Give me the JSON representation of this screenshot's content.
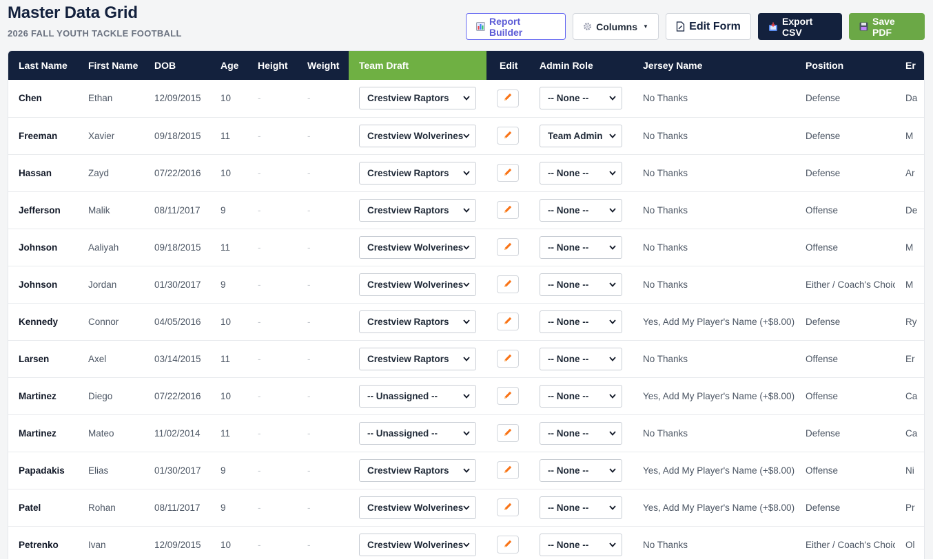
{
  "header": {
    "title": "Master Data Grid",
    "subtitle": "2026 FALL YOUTH TACKLE FOOTBALL"
  },
  "toolbar": {
    "report_builder": "Report Builder",
    "columns": "Columns",
    "edit_form": "Edit Form",
    "export_csv": "Export CSV",
    "save_pdf": "Save PDF",
    "report_icon": "chart-icon",
    "columns_icon": "gear-icon",
    "edit_form_icon": "document-edit-icon",
    "export_icon": "export-icon",
    "pdf_icon": "save-disk-icon",
    "colors": {
      "navy": "#13213d",
      "green": "#6ba846",
      "accent": "#5b5bd6"
    }
  },
  "grid": {
    "columns": [
      "Last Name",
      "First Name",
      "DOB",
      "Age",
      "Height",
      "Weight",
      "Team Draft",
      "Edit",
      "Admin Role",
      "Jersey Name",
      "Position",
      "Er"
    ],
    "rows": [
      {
        "last": "Chen",
        "first": "Ethan",
        "dob": "12/09/2015",
        "age": "10",
        "height": "-",
        "weight": "-",
        "team": "Crestview Raptors",
        "admin": "-- None --",
        "jersey": "No Thanks",
        "position": "Defense",
        "extra": "Da"
      },
      {
        "last": "Freeman",
        "first": "Xavier",
        "dob": "09/18/2015",
        "age": "11",
        "height": "-",
        "weight": "-",
        "team": "Crestview Wolverines",
        "admin": "Team Admin",
        "jersey": "No Thanks",
        "position": "Defense",
        "extra": "M"
      },
      {
        "last": "Hassan",
        "first": "Zayd",
        "dob": "07/22/2016",
        "age": "10",
        "height": "-",
        "weight": "-",
        "team": "Crestview Raptors",
        "admin": "-- None --",
        "jersey": "No Thanks",
        "position": "Defense",
        "extra": "Ar"
      },
      {
        "last": "Jefferson",
        "first": "Malik",
        "dob": "08/11/2017",
        "age": "9",
        "height": "-",
        "weight": "-",
        "team": "Crestview Raptors",
        "admin": "-- None --",
        "jersey": "No Thanks",
        "position": "Offense",
        "extra": "De"
      },
      {
        "last": "Johnson",
        "first": "Aaliyah",
        "dob": "09/18/2015",
        "age": "11",
        "height": "-",
        "weight": "-",
        "team": "Crestview Wolverines",
        "admin": "-- None --",
        "jersey": "No Thanks",
        "position": "Offense",
        "extra": "M"
      },
      {
        "last": "Johnson",
        "first": "Jordan",
        "dob": "01/30/2017",
        "age": "9",
        "height": "-",
        "weight": "-",
        "team": "Crestview Wolverines",
        "admin": "-- None --",
        "jersey": "No Thanks",
        "position": "Either / Coach's Choice",
        "extra": "M"
      },
      {
        "last": "Kennedy",
        "first": "Connor",
        "dob": "04/05/2016",
        "age": "10",
        "height": "-",
        "weight": "-",
        "team": "Crestview Raptors",
        "admin": "-- None --",
        "jersey": "Yes, Add My Player's Name (+$8.00)",
        "position": "Defense",
        "extra": "Ry"
      },
      {
        "last": "Larsen",
        "first": "Axel",
        "dob": "03/14/2015",
        "age": "11",
        "height": "-",
        "weight": "-",
        "team": "Crestview Raptors",
        "admin": "-- None --",
        "jersey": "No Thanks",
        "position": "Offense",
        "extra": "Er"
      },
      {
        "last": "Martinez",
        "first": "Diego",
        "dob": "07/22/2016",
        "age": "10",
        "height": "-",
        "weight": "-",
        "team": "-- Unassigned --",
        "admin": "-- None --",
        "jersey": "Yes, Add My Player's Name (+$8.00)",
        "position": "Offense",
        "extra": "Ca"
      },
      {
        "last": "Martinez",
        "first": "Mateo",
        "dob": "11/02/2014",
        "age": "11",
        "height": "-",
        "weight": "-",
        "team": "-- Unassigned --",
        "admin": "-- None --",
        "jersey": "No Thanks",
        "position": "Defense",
        "extra": "Ca"
      },
      {
        "last": "Papadakis",
        "first": "Elias",
        "dob": "01/30/2017",
        "age": "9",
        "height": "-",
        "weight": "-",
        "team": "Crestview Raptors",
        "admin": "-- None --",
        "jersey": "Yes, Add My Player's Name (+$8.00)",
        "position": "Offense",
        "extra": "Ni"
      },
      {
        "last": "Patel",
        "first": "Rohan",
        "dob": "08/11/2017",
        "age": "9",
        "height": "-",
        "weight": "-",
        "team": "Crestview Wolverines",
        "admin": "-- None --",
        "jersey": "Yes, Add My Player's Name (+$8.00)",
        "position": "Defense",
        "extra": "Pr"
      },
      {
        "last": "Petrenko",
        "first": "Ivan",
        "dob": "12/09/2015",
        "age": "10",
        "height": "-",
        "weight": "-",
        "team": "Crestview Wolverines",
        "admin": "-- None --",
        "jersey": "No Thanks",
        "position": "Either / Coach's Choice",
        "extra": "Ol"
      }
    ]
  }
}
